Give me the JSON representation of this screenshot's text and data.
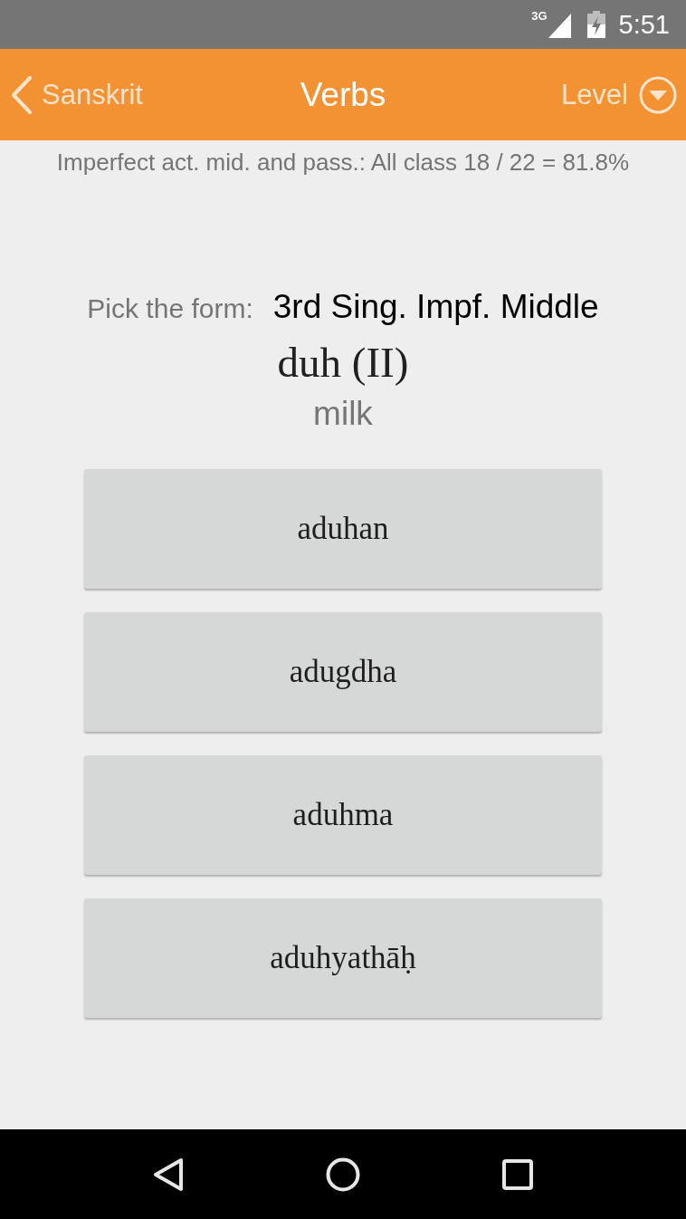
{
  "status_bar": {
    "network": "3G",
    "time": "5:51"
  },
  "app_bar": {
    "back_label": "Sanskrit",
    "title": "Verbs",
    "menu_label": "Level"
  },
  "score_line": "Imperfect act. mid. and pass.: All class 18 / 22 = 81.8%",
  "question": {
    "prompt": "Pick the form:",
    "target": "3rd Sing. Impf. Middle",
    "root": "duh (II)",
    "meaning": "milk"
  },
  "answers": [
    {
      "label": "aduhan"
    },
    {
      "label": "adugdha"
    },
    {
      "label": "aduhma"
    },
    {
      "label": "aduhyathāḥ"
    }
  ]
}
